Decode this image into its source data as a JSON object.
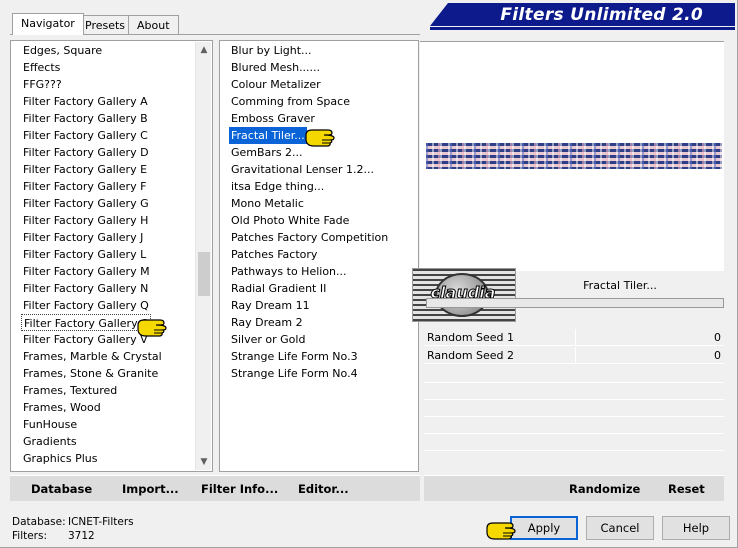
{
  "banner": {
    "title": "Filters Unlimited 2.0"
  },
  "tabs": [
    "Navigator",
    "Presets",
    "About"
  ],
  "categories": {
    "items": [
      "Edges, Square",
      "Effects",
      "FFG???",
      "Filter Factory Gallery A",
      "Filter Factory Gallery B",
      "Filter Factory Gallery C",
      "Filter Factory Gallery D",
      "Filter Factory Gallery E",
      "Filter Factory Gallery F",
      "Filter Factory Gallery G",
      "Filter Factory Gallery H",
      "Filter Factory Gallery J",
      "Filter Factory Gallery L",
      "Filter Factory Gallery M",
      "Filter Factory Gallery N",
      "Filter Factory Gallery Q",
      "Filter Factory Gallery S",
      "Filter Factory Gallery V",
      "Frames, Marble & Crystal",
      "Frames, Stone & Granite",
      "Frames, Textured",
      "Frames, Wood",
      "FunHouse",
      "Gradients",
      "Graphics Plus"
    ],
    "selected": "Filter Factory Gallery S"
  },
  "filters": {
    "items": [
      "Blur by Light...",
      "Blured Mesh......",
      "Colour Metalizer",
      "Comming from Space",
      "Emboss Graver",
      "Fractal Tiler...",
      "GemBars 2...",
      "Gravitational Lenser 1.2...",
      "itsa Edge thing...",
      "Mono Metalic",
      "Old Photo White Fade",
      "Patches Factory Competition",
      "Patches Factory",
      "Pathways to Helion...",
      "Radial Gradient II",
      "Ray Dream 11",
      "Ray Dream 2",
      "Silver or Gold",
      "Strange Life Form No.3",
      "Strange Life Form No.4"
    ],
    "selected": "Fractal Tiler..."
  },
  "logo": {
    "text": "claudia"
  },
  "filter_name": "Fractal Tiler...",
  "params": [
    {
      "label": "Random Seed 1",
      "value": "0"
    },
    {
      "label": "Random Seed 2",
      "value": "0"
    }
  ],
  "left_bar": {
    "database": "Database",
    "import": "Import...",
    "filter_info": "Filter Info...",
    "editor": "Editor..."
  },
  "right_bar": {
    "randomize": "Randomize",
    "reset": "Reset"
  },
  "status": {
    "database_label": "Database:",
    "database_value": "ICNET-Filters",
    "filters_label": "Filters:",
    "filters_value": "3712"
  },
  "buttons": {
    "apply": "Apply",
    "cancel": "Cancel",
    "help": "Help"
  },
  "colors": {
    "banner": "#0c1a8c",
    "selection": "#0a64d8",
    "hand_pointer": "#f5d800"
  }
}
